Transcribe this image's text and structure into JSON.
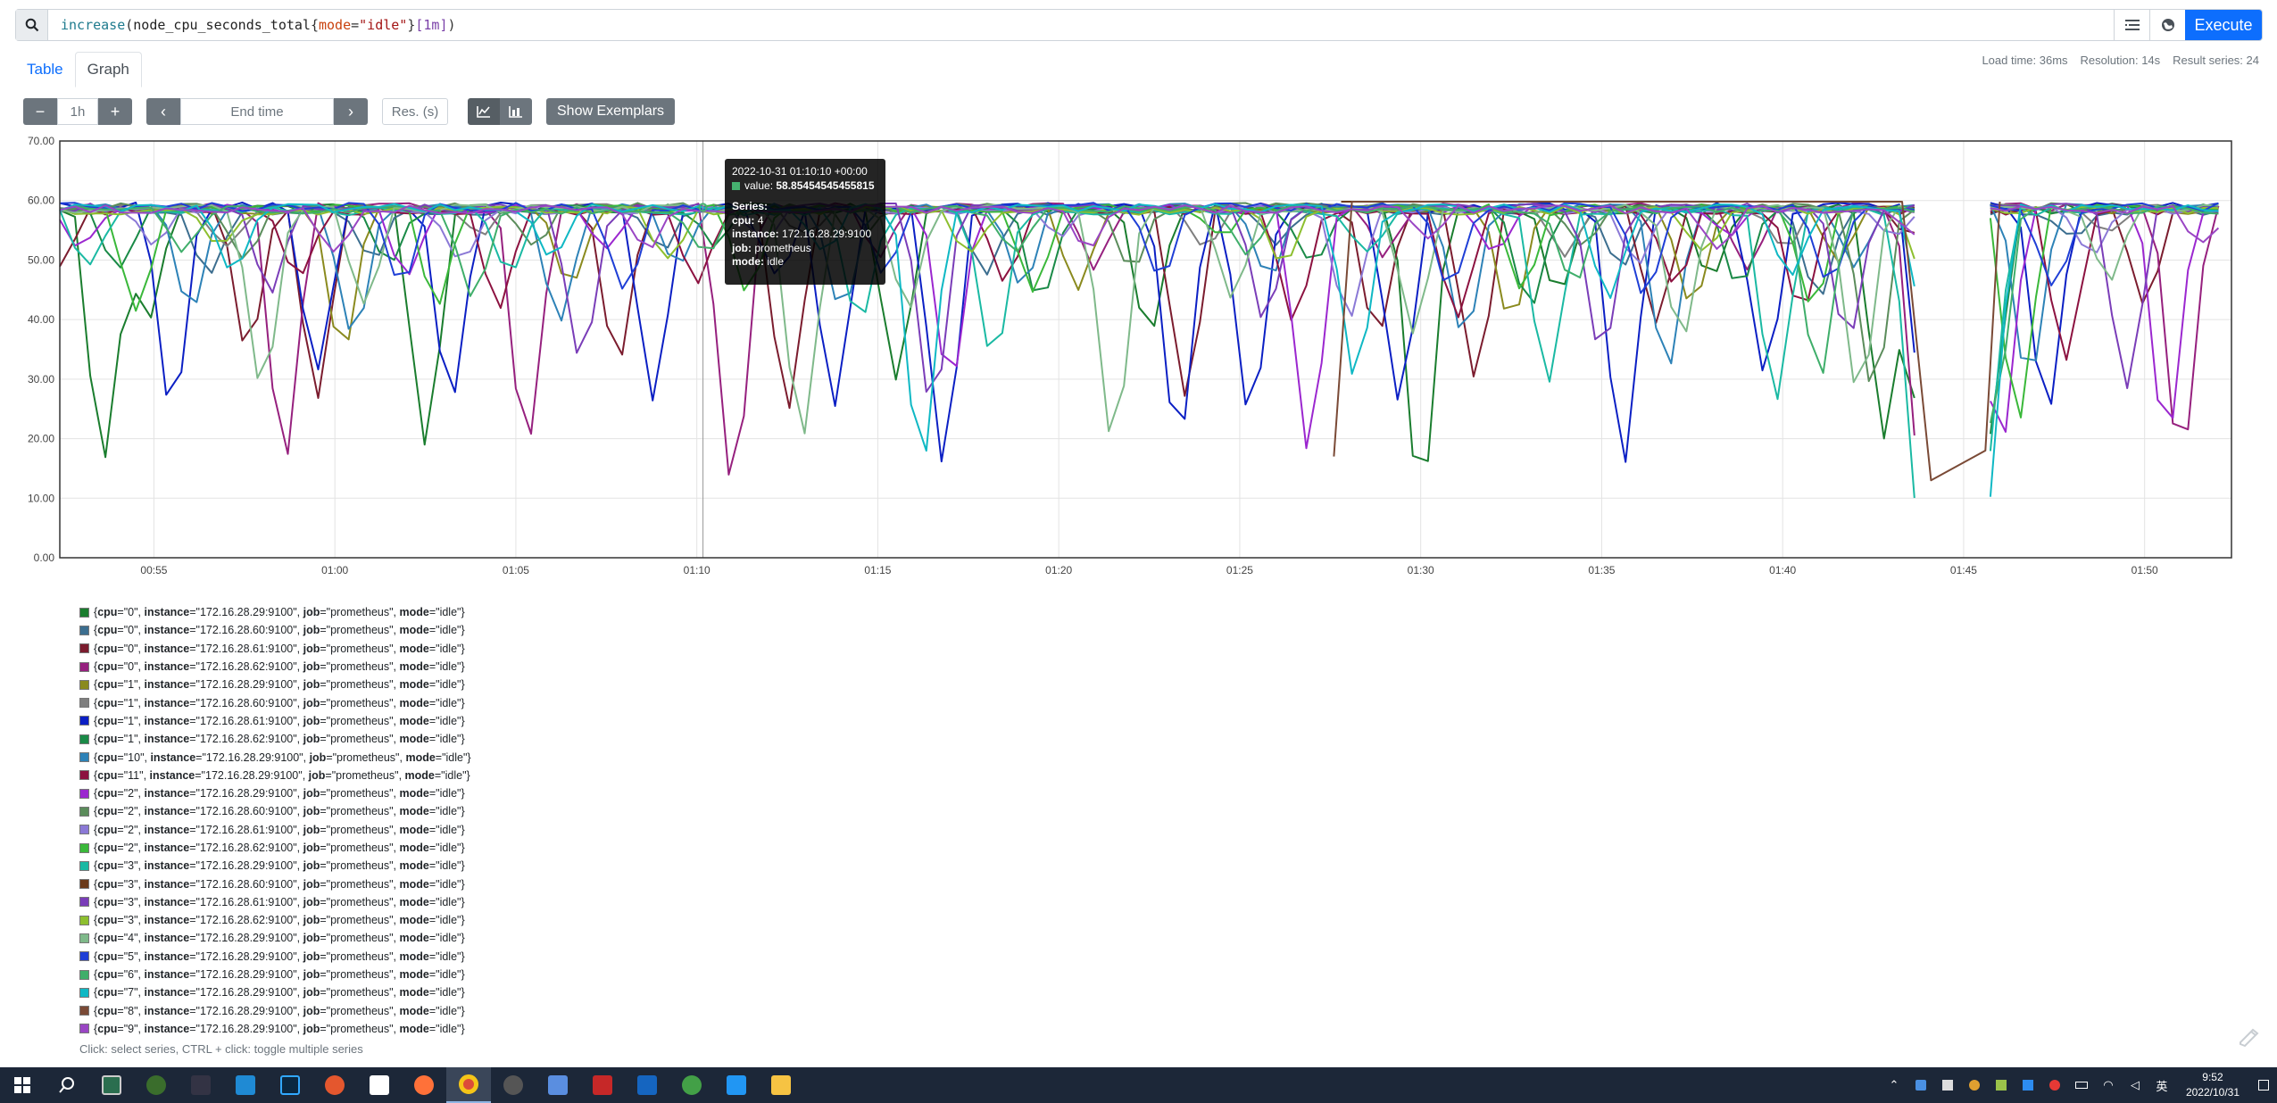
{
  "query": {
    "fn": "increase",
    "metric": "node_cpu_seconds_total",
    "label_key": "mode",
    "label_value": "\"idle\"",
    "range": "[1m]",
    "execute_label": "Execute"
  },
  "tabs": [
    {
      "label": "Table",
      "active": false
    },
    {
      "label": "Graph",
      "active": true
    }
  ],
  "stats": {
    "load_time": "Load time: 36ms",
    "resolution": "Resolution: 14s",
    "result_series": "Result series: 24"
  },
  "controls": {
    "minus": "−",
    "range": "1h",
    "plus": "+",
    "prev": "‹",
    "end_time_placeholder": "End time",
    "next": "›",
    "res_placeholder": "Res. (s)",
    "show_exemplars": "Show Exemplars"
  },
  "tooltip": {
    "time": "2022-10-31 01:10:10 +00:00",
    "value_label": "value:",
    "value": "58.85454545455815",
    "series_heading": "Series:",
    "labels": [
      {
        "k": "cpu:",
        "v": "4"
      },
      {
        "k": "instance:",
        "v": "172.16.28.29:9100"
      },
      {
        "k": "job:",
        "v": "prometheus"
      },
      {
        "k": "mode:",
        "v": "idle"
      }
    ]
  },
  "chart_data": {
    "type": "line",
    "y_ticks": [
      "70.00",
      "60.00",
      "50.00",
      "40.00",
      "30.00",
      "20.00",
      "10.00",
      "0.00"
    ],
    "ylim": [
      0,
      70
    ],
    "x_ticks": [
      "00:55",
      "01:00",
      "01:05",
      "01:10",
      "01:15",
      "01:20",
      "01:25",
      "01:30",
      "01:35",
      "01:40",
      "01:45",
      "01:50"
    ],
    "x_range_minutes": [
      52.4,
      112.4
    ],
    "x_tick_minutes": [
      55,
      60,
      65,
      70,
      75,
      80,
      85,
      90,
      95,
      100,
      105,
      110
    ],
    "gap_minutes": [
      104.0,
      105.6
    ],
    "grid": true,
    "series": [
      {
        "name": "{cpu=\"0\", instance=\"172.16.28.29:9100\", job=\"prometheus\", mode=\"idle\"}",
        "color": "#1a7d2e",
        "dips": [
          [
            53.6,
            16
          ],
          [
            54.8,
            40
          ],
          [
            62.5,
            19
          ],
          [
            75.5,
            30
          ],
          [
            82.5,
            38
          ],
          [
            90.0,
            11
          ],
          [
            93.8,
            45
          ],
          [
            98.0,
            47
          ],
          [
            102.8,
            20
          ],
          [
            104.0,
            10
          ]
        ]
      },
      {
        "name": "{cpu=\"0\", instance=\"172.16.28.60:9100\", job=\"prometheus\", mode=\"idle\"}",
        "color": "#3c6e8f",
        "dips": [
          [
            56.5,
            47
          ],
          [
            61.0,
            50
          ],
          [
            69.0,
            52
          ],
          [
            78.0,
            48
          ],
          [
            86.0,
            53
          ],
          [
            95.5,
            49
          ],
          [
            101.0,
            44
          ],
          [
            108.0,
            54
          ]
        ]
      },
      {
        "name": "{cpu=\"0\", instance=\"172.16.28.61:9100\", job=\"prometheus\", mode=\"idle\"}",
        "color": "#7b1c2e",
        "dips": [
          [
            52.4,
            49
          ],
          [
            57.6,
            35
          ],
          [
            59.5,
            27
          ],
          [
            67.8,
            33
          ],
          [
            72.5,
            25
          ],
          [
            83.5,
            27
          ],
          [
            88.8,
            38
          ],
          [
            91.5,
            30
          ],
          [
            96.5,
            40
          ],
          [
            103.5,
            55
          ],
          [
            110.0,
            43
          ]
        ]
      },
      {
        "name": "{cpu=\"0\", instance=\"172.16.28.62:9100\", job=\"prometheus\", mode=\"idle\"}",
        "color": "#96207e",
        "dips": [
          [
            58.6,
            16
          ],
          [
            65.3,
            19
          ],
          [
            71.0,
            12
          ],
          [
            75.0,
            51
          ],
          [
            81.0,
            49
          ],
          [
            89.0,
            51
          ],
          [
            99.0,
            49
          ],
          [
            103.9,
            12
          ],
          [
            111.0,
            16
          ]
        ]
      },
      {
        "name": "{cpu=\"1\", instance=\"172.16.28.29:9100\", job=\"prometheus\", mode=\"idle\"}",
        "color": "#8a8a1e",
        "dips": [
          [
            60.2,
            35
          ],
          [
            66.5,
            46
          ],
          [
            80.5,
            45
          ],
          [
            92.5,
            40
          ],
          [
            97.5,
            42
          ],
          [
            101.5,
            50
          ]
        ]
      },
      {
        "name": "{cpu=\"1\", instance=\"172.16.28.60:9100\", job=\"prometheus\", mode=\"idle\"}",
        "color": "#7f7f7f",
        "dips": [
          [
            57.0,
            53
          ],
          [
            64.0,
            54
          ],
          [
            73.0,
            54
          ],
          [
            84.0,
            52
          ],
          [
            94.0,
            51
          ],
          [
            100.0,
            52
          ],
          [
            109.0,
            55
          ]
        ]
      },
      {
        "name": "{cpu=\"1\", instance=\"172.16.28.61:9100\", job=\"prometheus\", mode=\"idle\"}",
        "color": "#0b1fc4",
        "dips": [
          [
            55.5,
            25
          ],
          [
            59.5,
            32
          ],
          [
            63.2,
            26
          ],
          [
            68.8,
            27
          ],
          [
            72.2,
            47
          ],
          [
            73.8,
            25
          ],
          [
            76.8,
            16
          ],
          [
            83.3,
            19
          ],
          [
            85.3,
            24
          ],
          [
            89.4,
            27
          ],
          [
            95.6,
            16
          ],
          [
            99.5,
            31
          ],
          [
            104.1,
            8
          ],
          [
            107.3,
            25
          ]
        ]
      },
      {
        "name": "{cpu=\"1\", instance=\"172.16.28.62:9100\", job=\"prometheus\", mode=\"idle\"}",
        "color": "#1a8a47",
        "dips": [
          [
            54.0,
            48
          ],
          [
            61.5,
            50
          ],
          [
            70.5,
            52
          ],
          [
            79.5,
            43
          ],
          [
            87.0,
            49
          ],
          [
            93.0,
            42
          ],
          [
            98.8,
            46
          ],
          [
            105.7,
            20
          ]
        ]
      },
      {
        "name": "{cpu=\"10\", instance=\"172.16.28.29:9100\", job=\"prometheus\", mode=\"idle\"}",
        "color": "#2d82b7",
        "dips": [
          [
            56.0,
            42
          ],
          [
            60.5,
            37
          ],
          [
            66.2,
            40
          ],
          [
            69.5,
            49
          ],
          [
            74.0,
            42
          ],
          [
            79.0,
            46
          ],
          [
            85.8,
            47
          ],
          [
            91.2,
            37
          ],
          [
            96.8,
            32
          ],
          [
            102.0,
            49
          ],
          [
            106.8,
            30
          ]
        ]
      },
      {
        "name": "{cpu=\"11\", instance=\"172.16.28.29:9100\", job=\"prometheus\", mode=\"idle\"}",
        "color": "#8c1240",
        "dips": [
          [
            59.0,
            47
          ],
          [
            64.5,
            42
          ],
          [
            70.0,
            46
          ],
          [
            78.5,
            47
          ],
          [
            86.5,
            39
          ],
          [
            91.0,
            40
          ],
          [
            97.0,
            46
          ],
          [
            100.5,
            41
          ],
          [
            107.8,
            33
          ]
        ]
      },
      {
        "name": "{cpu=\"2\", instance=\"172.16.28.29:9100\", job=\"prometheus\", mode=\"idle\"}",
        "color": "#9b27cf",
        "dips": [
          [
            53.0,
            52
          ],
          [
            62.0,
            47
          ],
          [
            67.5,
            52
          ],
          [
            77.0,
            29
          ],
          [
            86.9,
            18
          ],
          [
            92.0,
            51
          ],
          [
            98.5,
            54
          ],
          [
            106.0,
            18
          ],
          [
            110.6,
            20
          ]
        ]
      },
      {
        "name": "{cpu=\"2\", instance=\"172.16.28.60:9100\", job=\"prometheus\", mode=\"idle\"}",
        "color": "#5b8c5b",
        "dips": [
          [
            57.5,
            50
          ],
          [
            65.5,
            52
          ],
          [
            74.5,
            53
          ],
          [
            82.0,
            48
          ],
          [
            94.5,
            53
          ],
          [
            102.5,
            28
          ]
        ]
      },
      {
        "name": "{cpu=\"2\", instance=\"172.16.28.61:9100\", job=\"prometheus\", mode=\"idle\"}",
        "color": "#8b79d6",
        "dips": [
          [
            55.0,
            53
          ],
          [
            63.5,
            50
          ],
          [
            71.8,
            54
          ],
          [
            80.0,
            54
          ],
          [
            88.0,
            40
          ],
          [
            96.0,
            50
          ],
          [
            103.0,
            54
          ],
          [
            108.5,
            51
          ]
        ]
      },
      {
        "name": "{cpu=\"2\", instance=\"172.16.28.62:9100\", job=\"prometheus\", mode=\"idle\"}",
        "color": "#3ab83a",
        "dips": [
          [
            54.5,
            41
          ],
          [
            62.8,
            42
          ],
          [
            71.4,
            45
          ],
          [
            79.3,
            44
          ],
          [
            84.5,
            54
          ],
          [
            92.8,
            45
          ],
          [
            100.8,
            42
          ],
          [
            106.5,
            23
          ]
        ]
      },
      {
        "name": "{cpu=\"3\", instance=\"172.16.28.29:9100\", job=\"prometheus\", mode=\"idle\"}",
        "color": "#1ab9a3",
        "dips": [
          [
            53.2,
            49
          ],
          [
            64.8,
            48
          ],
          [
            74.5,
            40
          ],
          [
            78.2,
            33
          ],
          [
            88.5,
            51
          ],
          [
            93.5,
            29
          ],
          [
            99.8,
            27
          ],
          [
            103.8,
            6
          ],
          [
            105.6,
            15
          ]
        ]
      },
      {
        "name": "{cpu=\"3\", instance=\"172.16.28.60:9100\", job=\"prometheus\", mode=\"idle\"}",
        "color": "#6b3a1a",
        "dips": [
          [
            70.8,
            47
          ]
        ],
        "plateau": [
          [
            87.8,
            59.8
          ],
          [
            103.0,
            59.8
          ],
          [
            105.9,
            59.8
          ],
          [
            112.4,
            59.8
          ]
        ]
      },
      {
        "name": "{cpu=\"3\", instance=\"172.16.28.61:9100\", job=\"prometheus\", mode=\"idle\"}",
        "color": "#7a3db8",
        "dips": [
          [
            58.2,
            44
          ],
          [
            66.8,
            33
          ],
          [
            76.5,
            25
          ],
          [
            85.7,
            40
          ],
          [
            95.0,
            34
          ],
          [
            101.8,
            37
          ],
          [
            109.5,
            28
          ]
        ]
      },
      {
        "name": "{cpu=\"3\", instance=\"172.16.28.62:9100\", job=\"prometheus\", mode=\"idle\"}",
        "color": "#8dbf2f",
        "dips": [
          [
            56.8,
            52
          ],
          [
            69.2,
            50
          ],
          [
            77.5,
            51
          ],
          [
            86.2,
            50
          ],
          [
            97.8,
            52
          ],
          [
            104.0,
            45
          ]
        ]
      },
      {
        "name": "{cpu=\"4\", instance=\"172.16.28.29:9100\", job=\"prometheus\", mode=\"idle\"}",
        "color": "#7fb98a",
        "dips": [
          [
            58.0,
            29
          ],
          [
            60.8,
            42
          ],
          [
            72.9,
            20
          ],
          [
            75.8,
            42
          ],
          [
            81.5,
            19
          ],
          [
            84.8,
            44
          ],
          [
            89.8,
            38
          ],
          [
            97.2,
            37
          ],
          [
            102.1,
            27
          ],
          [
            109.0,
            47
          ]
        ]
      },
      {
        "name": "{cpu=\"5\", instance=\"172.16.28.29:9100\", job=\"prometheus\", mode=\"idle\"}",
        "color": "#1f3fd6",
        "dips": [
          [
            61.8,
            46
          ],
          [
            68.0,
            45
          ],
          [
            75.2,
            48
          ],
          [
            82.8,
            47
          ],
          [
            90.8,
            46
          ],
          [
            96.2,
            44
          ],
          [
            101.3,
            46
          ],
          [
            107.5,
            45
          ]
        ]
      },
      {
        "name": "{cpu=\"6\", instance=\"172.16.28.29:9100\", job=\"prometheus\", mode=\"idle\"}",
        "color": "#3fae6a",
        "dips": [
          [
            55.8,
            52
          ],
          [
            63.8,
            44
          ],
          [
            70.2,
            51
          ],
          [
            78.8,
            51
          ],
          [
            85.2,
            51
          ],
          [
            94.2,
            46
          ],
          [
            101.0,
            30
          ],
          [
            105.8,
            22
          ]
        ]
      },
      {
        "name": "{cpu=\"7\", instance=\"172.16.28.29:9100\", job=\"prometheus\", mode=\"idle\"}",
        "color": "#0fb8c4",
        "dips": [
          [
            57.2,
            48
          ],
          [
            66.0,
            51
          ],
          [
            73.5,
            52
          ],
          [
            76.2,
            16
          ],
          [
            88.2,
            30
          ],
          [
            95.2,
            44
          ],
          [
            100.2,
            47
          ],
          [
            104.2,
            17
          ],
          [
            105.6,
            7
          ]
        ]
      },
      {
        "name": "{cpu=\"8\", instance=\"172.16.28.29:9100\", job=\"prometheus\", mode=\"idle\"}",
        "color": "#7a4a36",
        "dips": [],
        "plateau": [
          [
            87.6,
            17
          ],
          [
            88.1,
            59.8
          ],
          [
            103.3,
            59.8
          ],
          [
            104.1,
            13
          ],
          [
            105.6,
            18
          ],
          [
            106.0,
            59.8
          ],
          [
            112.4,
            59.8
          ]
        ]
      },
      {
        "name": "{cpu=\"9\", instance=\"172.16.28.29:9100\", job=\"prometheus\", mode=\"idle\"}",
        "color": "#9a46c4",
        "dips": [
          [
            60.0,
            51
          ],
          [
            68.6,
            52
          ],
          [
            80.8,
            52
          ],
          [
            90.2,
            53
          ],
          [
            98.2,
            52
          ],
          [
            103.6,
            54
          ],
          [
            111.6,
            53
          ]
        ]
      }
    ]
  },
  "legend_hint": "Click: select series, CTRL + click: toggle multiple series",
  "taskbar": {
    "time": "9:52",
    "date": "2022/10/31",
    "ime": "英"
  }
}
